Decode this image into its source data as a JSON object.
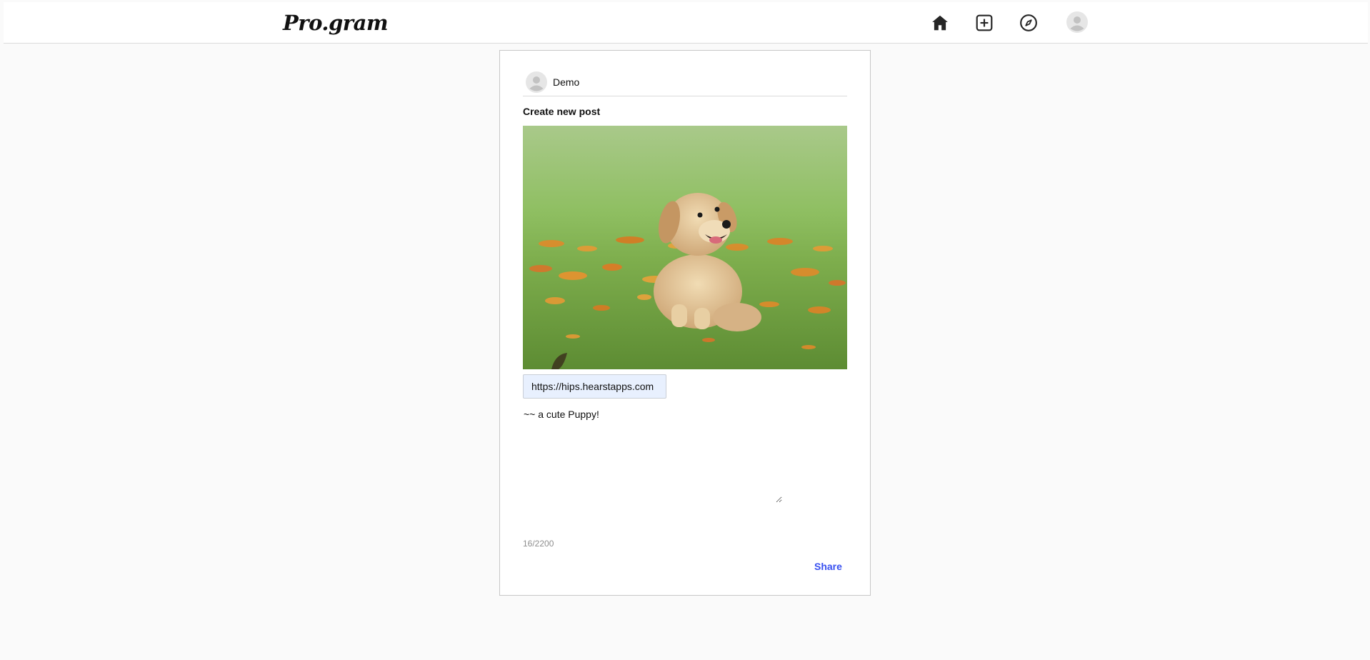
{
  "header": {
    "logo": "Pro.gram",
    "nav": {
      "home_icon": "home-icon",
      "new_post_icon": "plus-square-icon",
      "explore_icon": "compass-icon",
      "profile_icon": "avatar-icon"
    }
  },
  "post_form": {
    "username": "Demo",
    "title": "Create new post",
    "image_url": "https://hips.hearstapps.com",
    "caption": "~~ a cute Puppy!",
    "char_count": "16/2200",
    "share_label": "Share"
  },
  "colors": {
    "share": "#3850f0",
    "url_field_bg": "#e8f0fe",
    "page_bg": "#fafafa"
  }
}
